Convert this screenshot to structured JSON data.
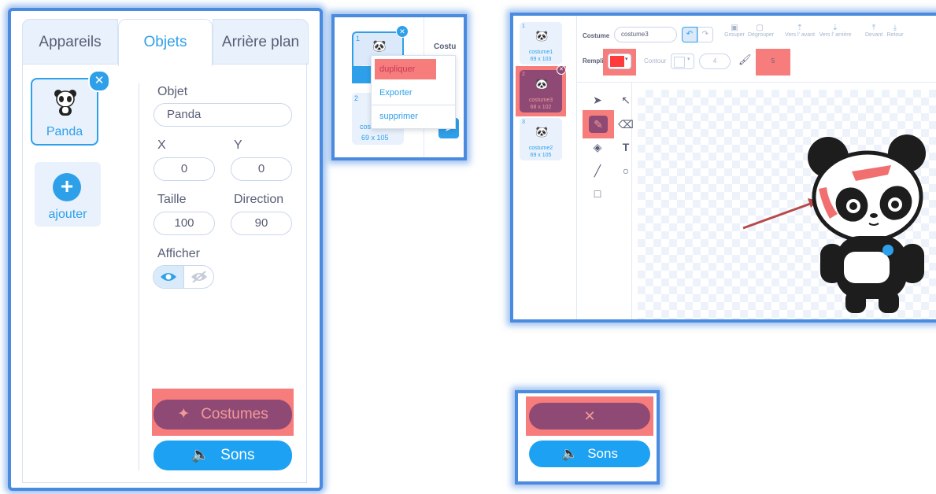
{
  "panel_sprites": {
    "tabs": [
      "Appareils",
      "Objets",
      "Arrière plan"
    ],
    "sprite": {
      "name": "Panda",
      "close_icon": "close-icon"
    },
    "add": {
      "label": "ajouter"
    },
    "fields": {
      "object_label": "Objet",
      "object_value": "Panda",
      "x_label": "X",
      "x_value": "0",
      "y_label": "Y",
      "y_value": "0",
      "size_label": "Taille",
      "size_value": "100",
      "direction_label": "Direction",
      "direction_value": "90",
      "show_label": "Afficher"
    },
    "costumes_button": "Costumes",
    "sounds_button": "Sons",
    "highlight_color": "#f77c7c",
    "accent_color": "#2ea0ea"
  },
  "panel_menu": {
    "thumb1_index": "1",
    "thumb1_name_partial": "co",
    "thumb1_size_partial": "69",
    "thumb2_index": "2",
    "thumb2_name": "costume2",
    "thumb2_size": "69 x 105",
    "costume_partial": "Costu",
    "menu_items": [
      "dupliquer",
      "Exporter",
      "supprimer"
    ]
  },
  "panel_editor": {
    "costumes": [
      {
        "index": "1",
        "name": "costume1",
        "size": "69 x 103"
      },
      {
        "index": "2",
        "name": "costume3",
        "size": "68 x 102"
      },
      {
        "index": "3",
        "name": "costume2",
        "size": "69 x 105"
      }
    ],
    "costume_label": "Costume",
    "costume_value": "costume3",
    "toolbar": {
      "group": "Grouper",
      "ungroup": "Dégrouper",
      "forward": "Vers l' avant",
      "backward": "Vers l' arrière",
      "front": "Devant",
      "back": "Retour"
    },
    "fill_label": "Remplir",
    "outline_label": "Contour",
    "outline_size": "4",
    "brush_size": "5",
    "fill_color": "#ff3b3b"
  },
  "panel_sounds": {
    "close_icon": "✕",
    "sounds_button": "Sons"
  }
}
